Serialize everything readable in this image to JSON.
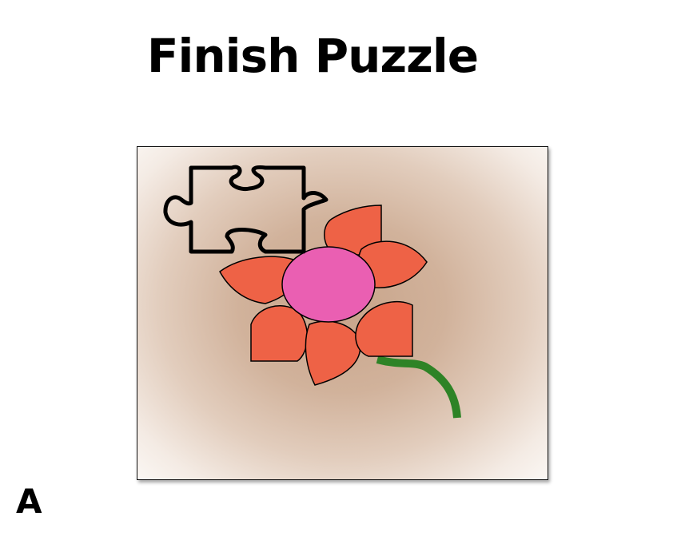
{
  "title": "Finish Puzzle",
  "panel_label": "A",
  "colors": {
    "petal": "#ee6246",
    "center": "#ea5fb2",
    "stem": "#2e8326",
    "outline": "#000000",
    "board_center": "#c8a48a",
    "board_edge": "#fbf8f5"
  },
  "icons": {
    "missing_piece": "puzzle-piece-outline-icon",
    "flower": "flower-icon"
  }
}
